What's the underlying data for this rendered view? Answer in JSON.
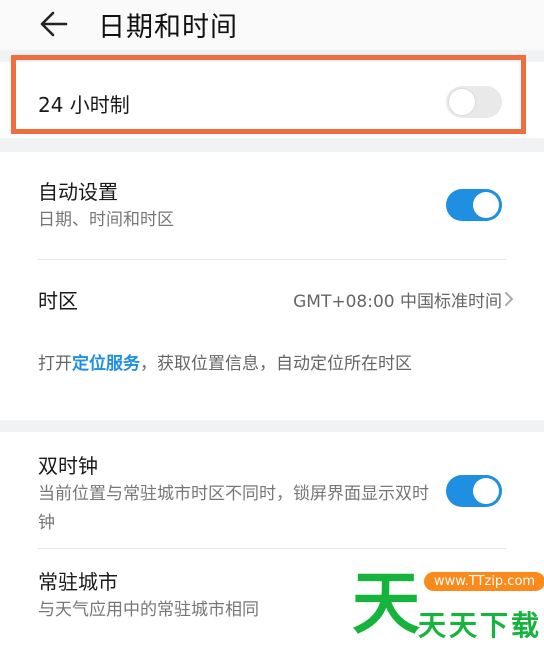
{
  "header": {
    "title": "日期和时间",
    "back_icon": "back-arrow-icon"
  },
  "hour24": {
    "label": "24 小时制",
    "enabled": false
  },
  "auto_set": {
    "title": "自动设置",
    "subtitle": "日期、时间和时区",
    "enabled": true
  },
  "timezone": {
    "label": "时区",
    "value": "GMT+08:00 中国标准时间"
  },
  "location_hint": {
    "prefix": "打开",
    "link": "定位服务",
    "suffix": "，获取位置信息，自动定位所在时区"
  },
  "dual_clock": {
    "title": "双时钟",
    "subtitle": "当前位置与常驻城市时区不同时，锁屏界面显示双时钟",
    "enabled": true
  },
  "home_city": {
    "title": "常驻城市",
    "subtitle": "与天气应用中的常驻城市相同"
  },
  "watermark": {
    "big": "天",
    "url": "www.TTzip.com",
    "text": "天天下载"
  },
  "colors": {
    "accent": "#1e8fe1",
    "highlight": "#f06e3e",
    "watermark": "#16b43c"
  }
}
